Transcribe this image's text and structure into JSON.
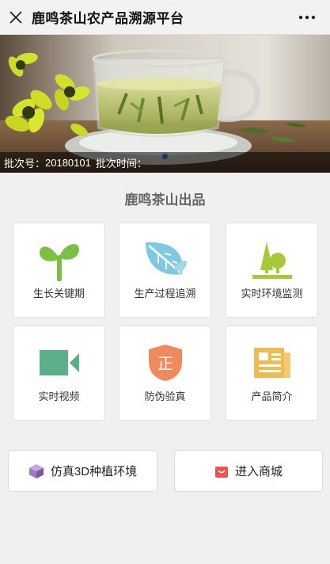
{
  "header": {
    "title": "鹿鸣茶山农产品溯源平台",
    "close_icon": "close-icon",
    "more_icon": "more-dots-icon"
  },
  "banner": {
    "batch_no_label": "批次号：",
    "batch_no": "20180101",
    "batch_time_label": "批次时间："
  },
  "section": {
    "title": "鹿鸣茶山出品"
  },
  "tiles": [
    {
      "label": "生长关键期",
      "icon": "sprout-icon",
      "color": "#7bc043"
    },
    {
      "label": "生产过程追溯",
      "icon": "leaf-icon",
      "color": "#7ec8e3"
    },
    {
      "label": "实时环境监测",
      "icon": "tree-icon",
      "color": "#a8c83a"
    },
    {
      "label": "实时视频",
      "icon": "video-camera-icon",
      "color": "#5bb08a"
    },
    {
      "label": "防伪验真",
      "icon": "shield-icon",
      "color": "#f08a5d",
      "glyph": "正"
    },
    {
      "label": "产品简介",
      "icon": "newspaper-icon",
      "color": "#f2bb4f"
    }
  ],
  "buttons": {
    "sim3d": {
      "label": "仿真3D种植环境",
      "icon": "cube-icon",
      "color": "#a079c4"
    },
    "mall": {
      "label": "进入商城",
      "icon": "shopping-bag-icon",
      "color": "#f0524b"
    }
  }
}
